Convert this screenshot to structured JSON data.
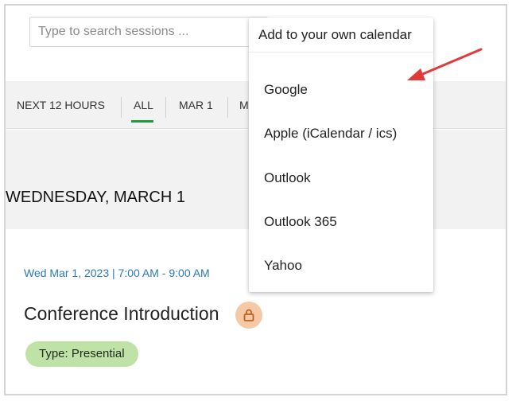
{
  "search": {
    "placeholder": "Type to search sessions ..."
  },
  "tabs": [
    {
      "label": "NEXT 12 HOURS"
    },
    {
      "label": "ALL"
    },
    {
      "label": "MAR 1"
    },
    {
      "label": "M"
    }
  ],
  "day_heading": "WEDNESDAY, MARCH 1",
  "session": {
    "time": "Wed Mar 1, 2023 | 7:00 AM  -  9:00 AM",
    "title": "Conference Introduction",
    "type_badge": "Type: Presential",
    "lock_icon": "lock-icon"
  },
  "calendar_menu": {
    "header": "Add to your own calendar",
    "items": [
      {
        "label": "Google"
      },
      {
        "label": "Apple (iCalendar / ics)"
      },
      {
        "label": "Outlook"
      },
      {
        "label": "Outlook 365"
      },
      {
        "label": "Yahoo"
      }
    ]
  },
  "colors": {
    "accent_green": "#1f9a3c",
    "time_blue": "#2a7ab7",
    "badge_green": "#bfe2a6",
    "lock_orange": "#f6c9a6",
    "arrow_red": "#e03a3a"
  }
}
